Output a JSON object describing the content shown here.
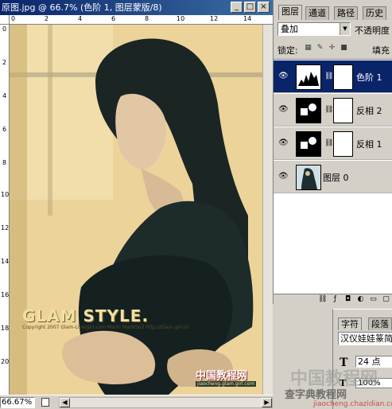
{
  "document": {
    "title": "原图.jpg @ 66.7% (色阶 1, 图层蒙版/8)",
    "zoom": "66.67%",
    "ruler_top_labels": [
      "0",
      "2",
      "4",
      "6",
      "8",
      "10",
      "12",
      "14"
    ],
    "ruler_left_labels": [
      "0",
      "2",
      "4",
      "6",
      "8",
      "10",
      "12",
      "14",
      "16",
      "18",
      "20"
    ]
  },
  "photo": {
    "brand": "GLAM STYLE.",
    "copyright": "Copyright 2007 Glam-Live/girl.com  Mark!  MarkOnZ  http://Glam.girl.cn",
    "logo_cn": "中国教程网",
    "logo_sub": "jiaocheng.glam.girl.com"
  },
  "layers_panel": {
    "tabs": [
      "图层",
      "通道",
      "路径",
      "历史"
    ],
    "blend_mode": "叠加",
    "opacity_label": "不透明度",
    "lock_label": "锁定:",
    "fill_label": "填充",
    "layers": [
      {
        "name": "色阶 1",
        "selected": true
      },
      {
        "name": "反相 2",
        "selected": false
      },
      {
        "name": "反相 1",
        "selected": false
      },
      {
        "name": "图层 0",
        "selected": false
      }
    ]
  },
  "character_panel": {
    "tabs": [
      "字符",
      "段落"
    ],
    "font": "汉仪娃娃篆简",
    "size": "24 点",
    "scale": "100%"
  },
  "watermark": {
    "line1": "中国教程网",
    "line2": "查字典教程网",
    "url": "jiaocheng.chazidian.com"
  }
}
